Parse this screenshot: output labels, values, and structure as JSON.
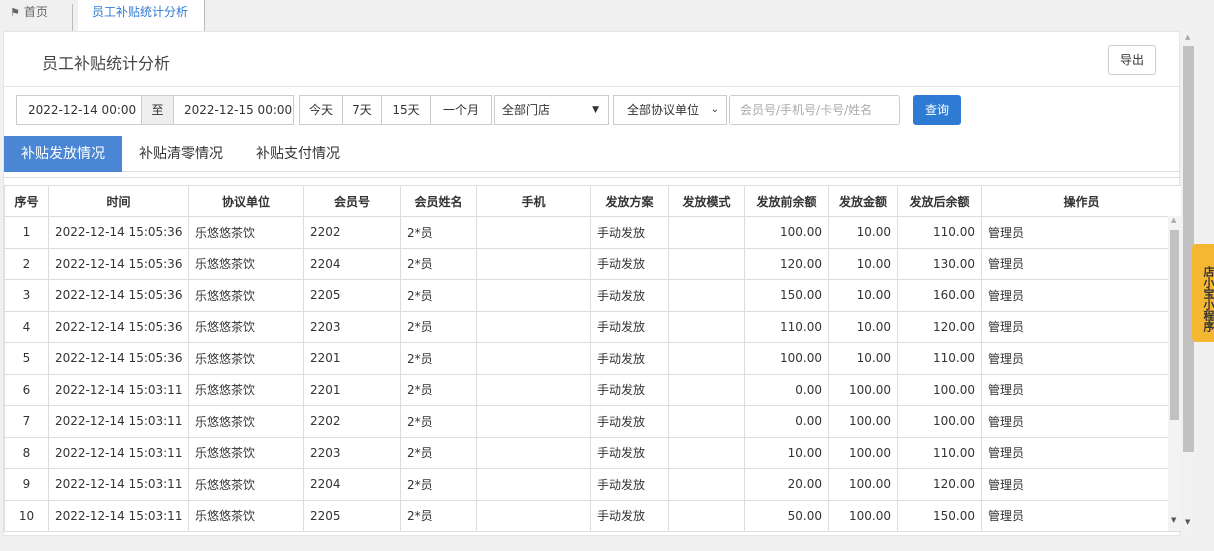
{
  "tabs": {
    "home_label": "首页",
    "active_label": "员工补贴统计分析"
  },
  "header": {
    "title": "员工补贴统计分析",
    "export_label": "导出"
  },
  "filters": {
    "date_start": "2022-12-14 00:00",
    "date_separator": "至",
    "date_end": "2022-12-15 00:00",
    "quick_ranges": [
      "今天",
      "7天",
      "15天",
      "一个月"
    ],
    "store_select": "全部门店",
    "unit_select": "全部协议单位",
    "search_placeholder": "会员号/手机号/卡号/姓名",
    "query_label": "查询"
  },
  "subtabs": [
    "补贴发放情况",
    "补贴清零情况",
    "补贴支付情况"
  ],
  "table": {
    "columns": [
      "序号",
      "时间",
      "协议单位",
      "会员号",
      "会员姓名",
      "手机",
      "发放方案",
      "发放模式",
      "发放前余额",
      "发放金额",
      "发放后余额",
      "操作员"
    ],
    "rows": [
      [
        "1",
        "2022-12-14 15:05:36",
        "乐悠悠茶饮",
        "2202",
        "2*员",
        "",
        "手动发放",
        "",
        "100.00",
        "10.00",
        "110.00",
        "管理员"
      ],
      [
        "2",
        "2022-12-14 15:05:36",
        "乐悠悠茶饮",
        "2204",
        "2*员",
        "",
        "手动发放",
        "",
        "120.00",
        "10.00",
        "130.00",
        "管理员"
      ],
      [
        "3",
        "2022-12-14 15:05:36",
        "乐悠悠茶饮",
        "2205",
        "2*员",
        "",
        "手动发放",
        "",
        "150.00",
        "10.00",
        "160.00",
        "管理员"
      ],
      [
        "4",
        "2022-12-14 15:05:36",
        "乐悠悠茶饮",
        "2203",
        "2*员",
        "",
        "手动发放",
        "",
        "110.00",
        "10.00",
        "120.00",
        "管理员"
      ],
      [
        "5",
        "2022-12-14 15:05:36",
        "乐悠悠茶饮",
        "2201",
        "2*员",
        "",
        "手动发放",
        "",
        "100.00",
        "10.00",
        "110.00",
        "管理员"
      ],
      [
        "6",
        "2022-12-14 15:03:11",
        "乐悠悠茶饮",
        "2201",
        "2*员",
        "",
        "手动发放",
        "",
        "0.00",
        "100.00",
        "100.00",
        "管理员"
      ],
      [
        "7",
        "2022-12-14 15:03:11",
        "乐悠悠茶饮",
        "2202",
        "2*员",
        "",
        "手动发放",
        "",
        "0.00",
        "100.00",
        "100.00",
        "管理员"
      ],
      [
        "8",
        "2022-12-14 15:03:11",
        "乐悠悠茶饮",
        "2203",
        "2*员",
        "",
        "手动发放",
        "",
        "10.00",
        "100.00",
        "110.00",
        "管理员"
      ],
      [
        "9",
        "2022-12-14 15:03:11",
        "乐悠悠茶饮",
        "2204",
        "2*员",
        "",
        "手动发放",
        "",
        "20.00",
        "100.00",
        "120.00",
        "管理员"
      ],
      [
        "10",
        "2022-12-14 15:03:11",
        "乐悠悠茶饮",
        "2205",
        "2*员",
        "",
        "手动发放",
        "",
        "50.00",
        "100.00",
        "150.00",
        "管理员"
      ]
    ]
  },
  "side_badge": "店小宝小程序",
  "colors": {
    "accent": "#2e7bd3",
    "subtab_active": "#4a86d4",
    "badge": "#f5b731"
  }
}
